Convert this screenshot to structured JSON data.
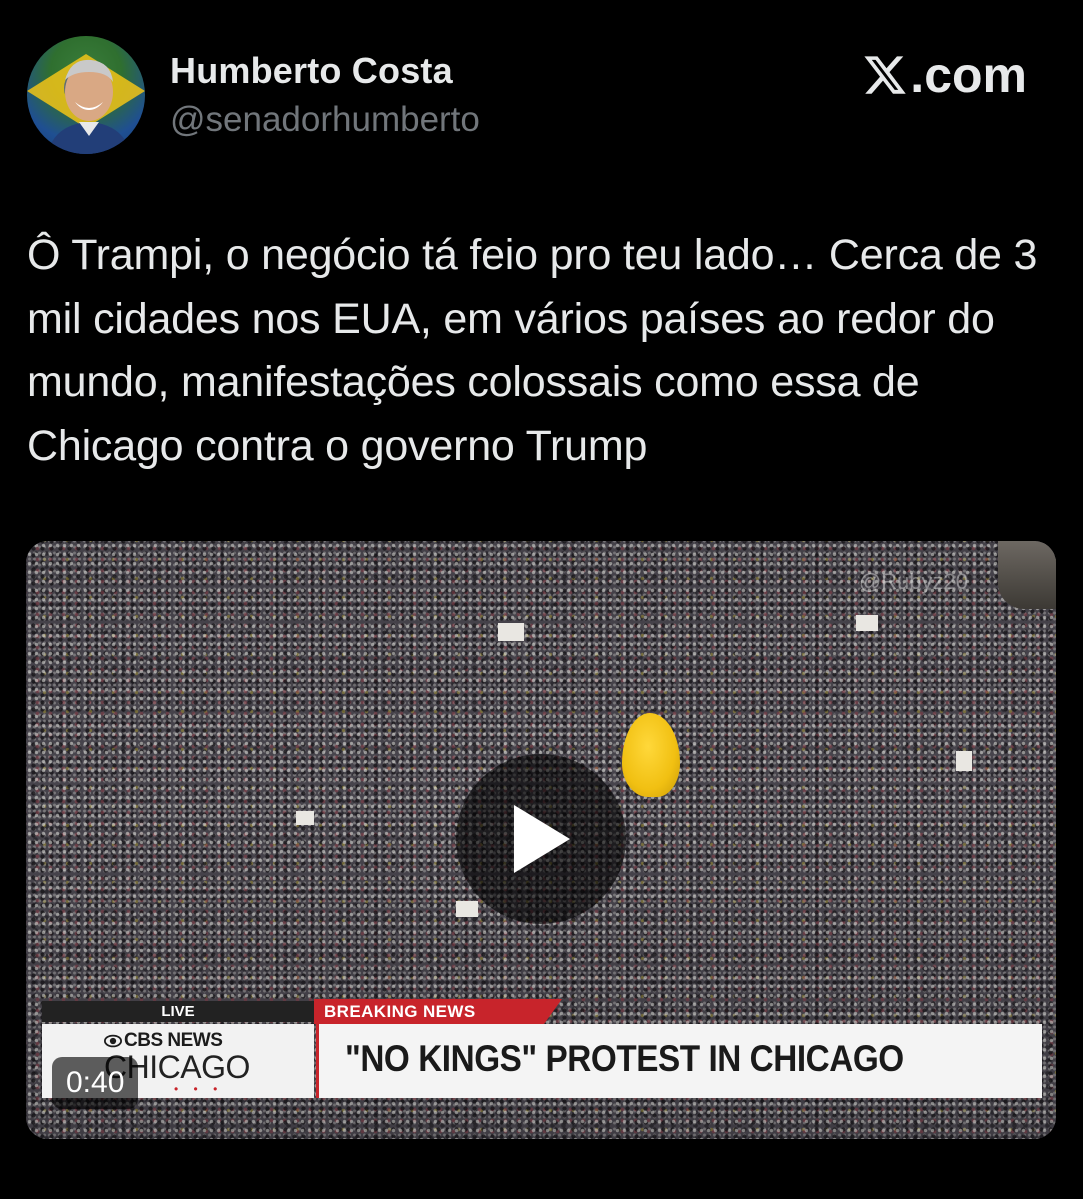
{
  "author": {
    "display_name": "Humberto Costa",
    "handle": "@senadorhumberto",
    "avatar_icon": "profile-photo-with-brazil-flag"
  },
  "brand": {
    "logo_icon": "x-logo-icon",
    "suffix": ".com"
  },
  "tweet": {
    "text": "Ô Trampi, o negócio tá feio pro teu lado…  Cerca de 3 mil cidades nos EUA, em vários países ao redor do mundo, manifestações colossais como essa de Chicago contra o governo Trump"
  },
  "video": {
    "duration": "0:40",
    "play_icon": "play-icon",
    "watermark": "@Rubyz20",
    "chyron": {
      "live_label": "LIVE",
      "breaking_label": "BREAKING NEWS",
      "network_name": "CBS NEWS",
      "network_city": "CHICAGO",
      "network_dots": "• • •",
      "headline": "\"NO KINGS\" PROTEST IN CHICAGO"
    }
  },
  "colors": {
    "background": "#000000",
    "primary_text": "#e7e9ea",
    "secondary_text": "#71767b",
    "breaking_red": "#c8242b"
  }
}
